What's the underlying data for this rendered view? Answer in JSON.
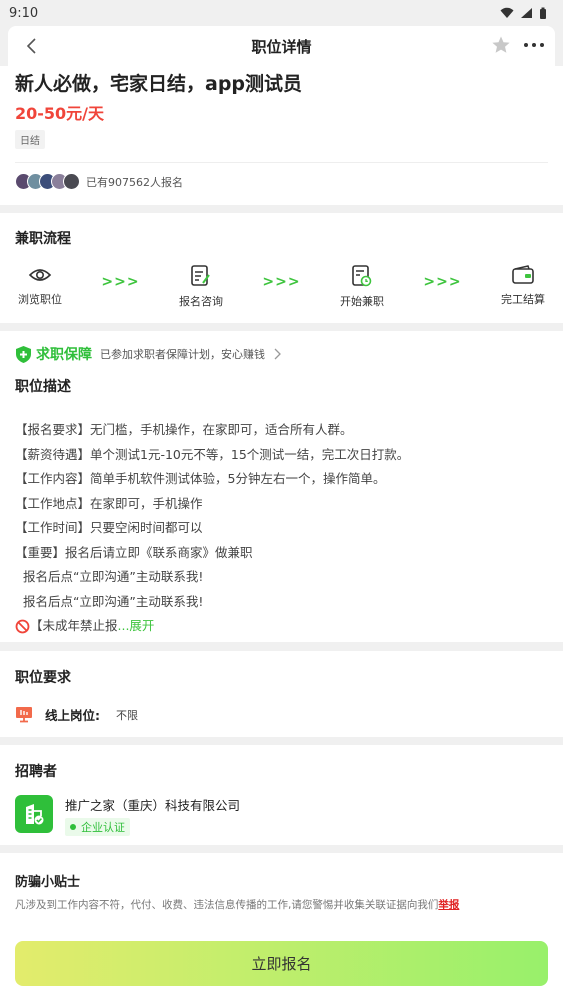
{
  "status_bar": {
    "time": "9:10"
  },
  "nav": {
    "title": "职位详情"
  },
  "job": {
    "title": "新人必做，宅家日结，app测试员",
    "salary": "20-50元/天",
    "tag": "日结",
    "applicants_text": "已有907562人报名"
  },
  "process": {
    "title": "兼职流程",
    "steps": [
      {
        "label": "浏览职位",
        "icon": "eye-icon"
      },
      {
        "label": "报名咨询",
        "icon": "form-edit-icon"
      },
      {
        "label": "开始兼职",
        "icon": "clock-document-icon"
      },
      {
        "label": "完工结算",
        "icon": "wallet-icon"
      }
    ],
    "arrow": ">>>"
  },
  "guarantee": {
    "brand": "求职保障",
    "text": "已参加求职者保障计划，安心赚钱"
  },
  "description": {
    "title": "职位描述",
    "lines": [
      "【报名要求】无门槛，手机操作，在家即可，适合所有人群。",
      "【薪资待遇】单个测试1元-10元不等，15个测试一结，完工次日打款。",
      "【工作内容】简单手机软件测试体验，5分钟左右一个，操作简单。",
      "【工作地点】在家即可，手机操作",
      "【工作时间】只要空闲时间都可以",
      "【重要】报名后请立即《联系商家》做兼职",
      "  报名后点“立即沟通”主动联系我!",
      "  报名后点“立即沟通”主动联系我!"
    ],
    "truncated_line": "【未成年禁止报",
    "expand_label": "...展开"
  },
  "requirements": {
    "title": "职位要求",
    "key": "线上岗位:",
    "value": "不限"
  },
  "recruiter": {
    "title": "招聘者",
    "company": "推广之家（重庆）科技有限公司",
    "badge": "企业认证"
  },
  "tips": {
    "title": "防骗小贴士",
    "text": "凡涉及到工作内容不符，代付、收费、违法信息传播的工作,请您警惕并收集关联证据向我们",
    "report_label": "举报"
  },
  "apply_button": "立即报名",
  "colors": {
    "accent_green": "#2fbf3a",
    "salary_red": "#f0453a",
    "report_red": "#e02020"
  }
}
